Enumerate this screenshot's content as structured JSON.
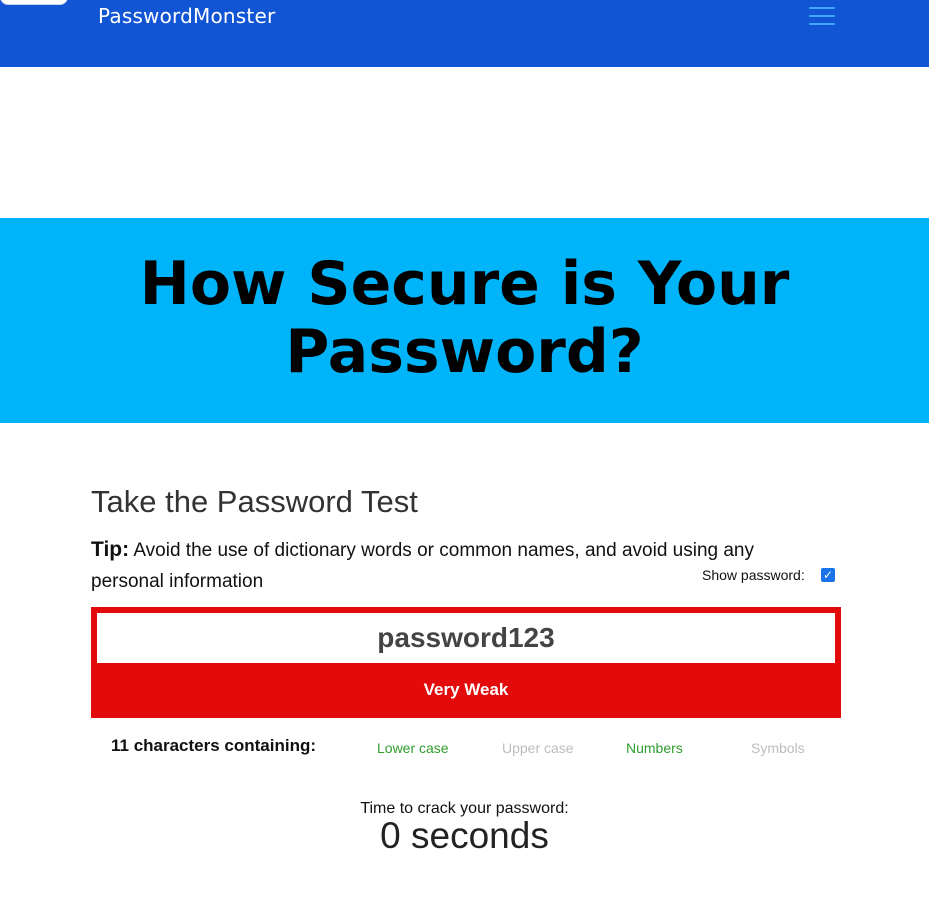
{
  "header": {
    "brand": "PasswordMonster",
    "menu_icon": "hamburger-menu-icon",
    "background_color": "#1155d4"
  },
  "hero": {
    "title_line1": "How Secure is Your",
    "title_line2": "Password?",
    "background_color": "#00b4fa"
  },
  "test": {
    "heading": "Take the Password Test",
    "tip_label": "Tip:",
    "tip_text": " Avoid the use of dictionary words or common names, and avoid using any personal information",
    "show_password_label": "Show password:",
    "show_password_checked": true,
    "password_value": "password123",
    "strength_label": "Very Weak",
    "strength_color": "#e20a0a",
    "char_summary": "11 characters containing:",
    "char_types": [
      {
        "label": "Lower case",
        "present": true,
        "color": "#2e9e2e"
      },
      {
        "label": "Upper case",
        "present": false,
        "color": "#bdbdbd"
      },
      {
        "label": "Numbers",
        "present": true,
        "color": "#2e9e2e"
      },
      {
        "label": "Symbols",
        "present": false,
        "color": "#bdbdbd"
      }
    ],
    "crack_label": "Time to crack your password:",
    "crack_value": "0 seconds"
  }
}
